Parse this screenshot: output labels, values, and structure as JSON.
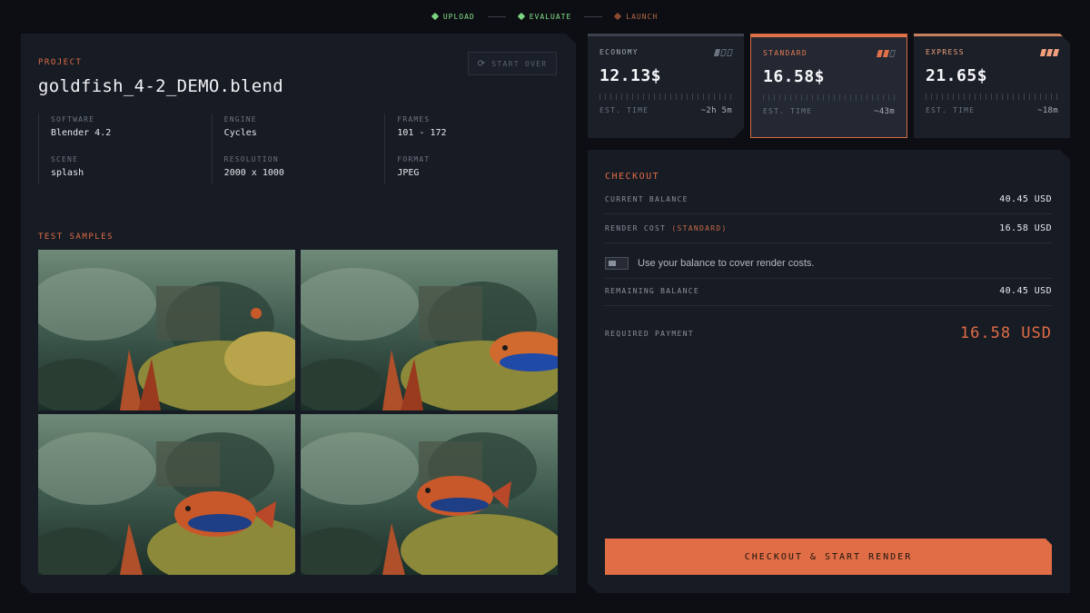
{
  "stepper": {
    "steps": [
      {
        "label": "UPLOAD",
        "state": "done"
      },
      {
        "label": "EVALUATE",
        "state": "done"
      },
      {
        "label": "LAUNCH",
        "state": "pending"
      }
    ]
  },
  "project": {
    "section_label": "PROJECT",
    "title": "goldfish_4-2_DEMO.blend",
    "start_over_label": "START OVER",
    "info": [
      {
        "key": "SOFTWARE",
        "value": "Blender 4.2"
      },
      {
        "key": "SCENE",
        "value": "splash"
      },
      {
        "key": "ENGINE",
        "value": "Cycles"
      },
      {
        "key": "RESOLUTION",
        "value": "2000 x 1000"
      },
      {
        "key": "FRAMES",
        "value": "101 - 172"
      },
      {
        "key": "FORMAT",
        "value": "JPEG"
      }
    ],
    "samples_label": "TEST SAMPLES",
    "samples": [
      {
        "fish": "none"
      },
      {
        "fish": "right-edge"
      },
      {
        "fish": "center"
      },
      {
        "fish": "center-right"
      }
    ]
  },
  "tiers": [
    {
      "name": "ECONOMY",
      "price": "12.13$",
      "time_label": "EST. TIME",
      "time": "~2h 5m",
      "level": 1,
      "selected": false
    },
    {
      "name": "STANDARD",
      "price": "16.58$",
      "time_label": "EST. TIME",
      "time": "~43m",
      "level": 2,
      "selected": true
    },
    {
      "name": "EXPRESS",
      "price": "21.65$",
      "time_label": "EST. TIME",
      "time": "~18m",
      "level": 3,
      "selected": false
    }
  ],
  "checkout": {
    "title": "CHECKOUT",
    "current_balance_label": "CURRENT BALANCE",
    "current_balance": "40.45 USD",
    "render_cost_label": "RENDER COST",
    "render_cost_tier": "(STANDARD)",
    "render_cost": "16.58 USD",
    "toggle_label": "Use your balance to cover render costs.",
    "toggle_on": false,
    "remaining_label": "REMAINING BALANCE",
    "remaining": "40.45 USD",
    "required_label": "REQUIRED PAYMENT",
    "required": "16.58 USD",
    "cta_label": "CHECKOUT & START RENDER"
  },
  "colors": {
    "accent": "#e06d45",
    "done": "#86e08a",
    "background": "#0c0e13",
    "panel": "#171b24"
  }
}
